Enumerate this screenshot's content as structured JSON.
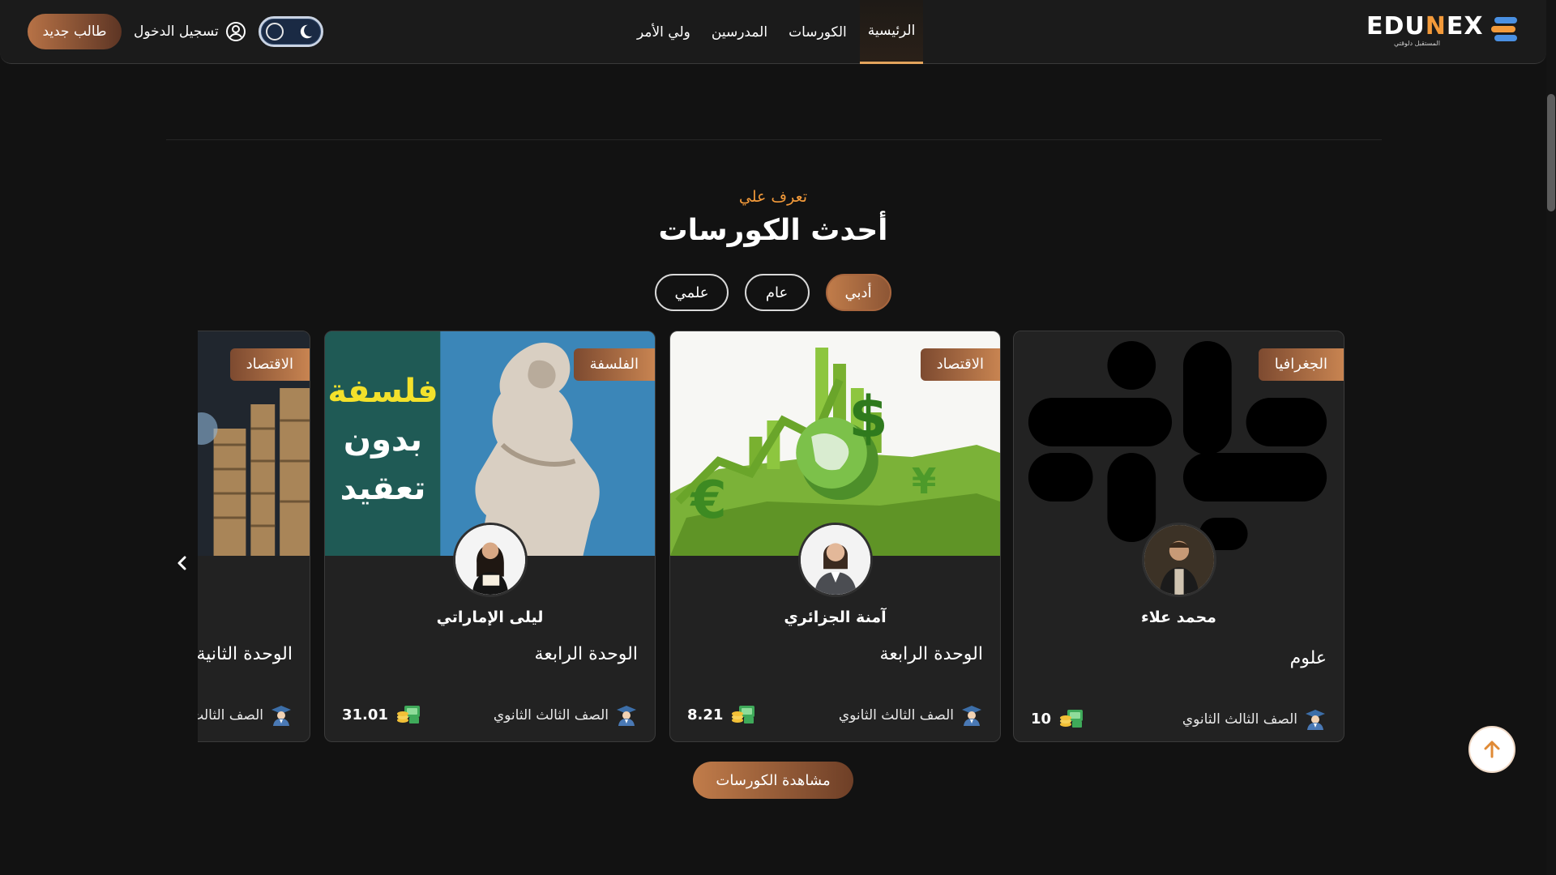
{
  "brand": {
    "logo_text_a": "EDU",
    "logo_text_b": "N",
    "logo_text_c": "EX",
    "tagline": "المستقبل دلوقتي",
    "accent_color": "#f39a3a"
  },
  "nav": {
    "items": [
      {
        "label": "الرئيسية",
        "active": true
      },
      {
        "label": "الكورسات",
        "active": false
      },
      {
        "label": "المدرسين",
        "active": false
      },
      {
        "label": "ولي الأمر",
        "active": false
      }
    ]
  },
  "header": {
    "login_label": "تسجيل الدخول",
    "signup_label": "طالب جديد",
    "theme_mode": "dark"
  },
  "section": {
    "eyebrow": "تعرف علي",
    "title": "أحدث الكورسات"
  },
  "filters": [
    {
      "label": "أدبي",
      "active": true
    },
    {
      "label": "عام",
      "active": false
    },
    {
      "label": "علمي",
      "active": false
    }
  ],
  "cards": [
    {
      "category": "الجغرافيا",
      "teacher": "محمد علاء",
      "title": "علوم",
      "grade": "الصف الثالث الثانوي",
      "price": "10",
      "image": "placeholder-logo"
    },
    {
      "category": "الاقتصاد",
      "teacher": "آمنة الجزائري",
      "title": "الوحدة الرابعة",
      "grade": "الصف الثالث الثانوي",
      "price": "8.21",
      "image": "economy-globe"
    },
    {
      "category": "الفلسفة",
      "teacher": "ليلى الإماراتي",
      "title": "الوحدة الرابعة",
      "grade": "الصف الثالث الثانوي",
      "price": "31.01",
      "image": "philosophy-statue",
      "image_text": [
        "فلسفة",
        "بدون",
        "تعقيد"
      ]
    },
    {
      "category": "الاقتصاد",
      "teacher": "",
      "title": "الوحدة الثانية",
      "grade": "الصف الثالث الثانوي",
      "price": "",
      "image": "coins-stack"
    }
  ],
  "actions": {
    "view_courses_label": "مشاهدة الكورسات"
  },
  "icons": {
    "login": "user-circle-icon",
    "theme_sun": "circle-icon",
    "theme_moon": "moon-icon",
    "grade": "graduate-icon",
    "price": "money-icon",
    "prev": "chevron-left-icon",
    "scroll_top": "arrow-up-icon"
  }
}
